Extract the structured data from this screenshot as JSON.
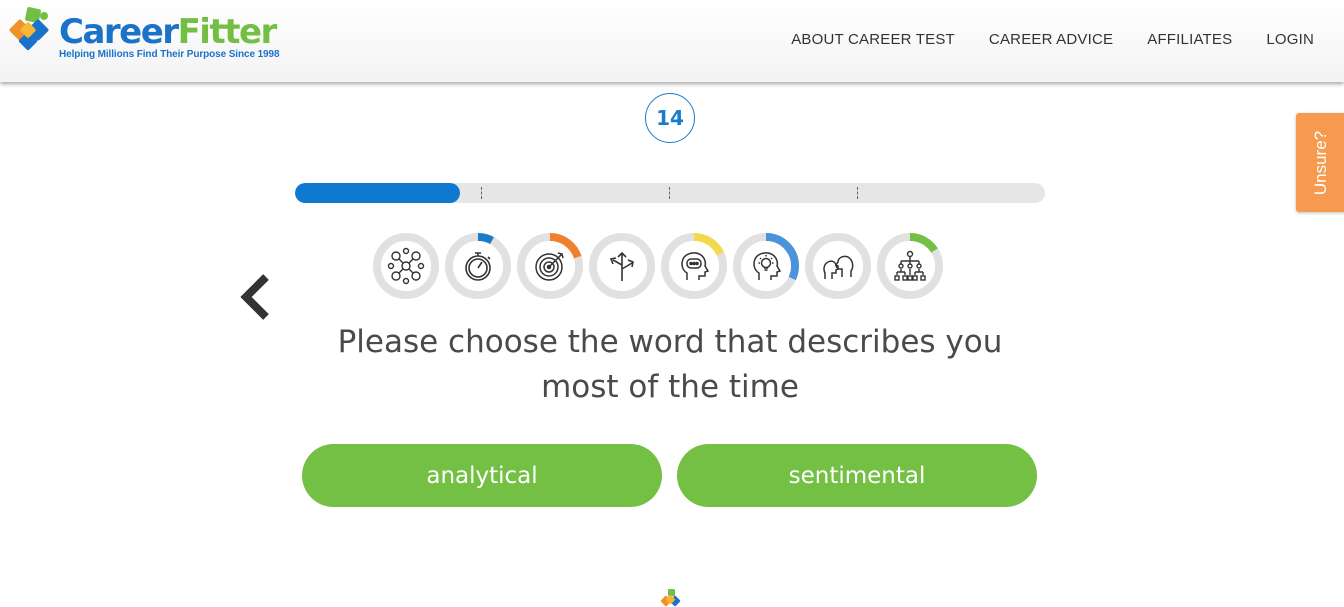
{
  "brand": {
    "name_part1": "Career",
    "name_part2": "Fitter",
    "tagline": "Helping Millions Find Their Purpose Since 1998",
    "blue": "#1a73c9",
    "green": "#72bf44",
    "orange": "#f0922b"
  },
  "nav": {
    "items": [
      {
        "label": "ABOUT CAREER TEST"
      },
      {
        "label": "CAREER ADVICE"
      },
      {
        "label": "AFFILIATES"
      },
      {
        "label": "LOGIN"
      }
    ]
  },
  "quiz": {
    "question_number": "14",
    "progress": 0.22,
    "sections": 4,
    "question": "Please choose the word that describes you most of the time",
    "answers": [
      {
        "label": "analytical"
      },
      {
        "label": "sentimental"
      }
    ],
    "unsure_label": "Unsure?",
    "back_icon": "chevron-left-icon"
  },
  "categories": [
    {
      "icon": "people-network-icon",
      "progress": 0,
      "color": "#1a7ccc"
    },
    {
      "icon": "stopwatch-icon",
      "progress": 0.08,
      "color": "#1a7ccc"
    },
    {
      "icon": "target-icon",
      "progress": 0.2,
      "color": "#f0802b"
    },
    {
      "icon": "crossroads-arrows-icon",
      "progress": 0,
      "color": "#1a7ccc"
    },
    {
      "icon": "head-speech-icon",
      "progress": 0.18,
      "color": "#f2d94e"
    },
    {
      "icon": "head-lightbulb-icon",
      "progress": 0.32,
      "color": "#4a94dc"
    },
    {
      "icon": "two-faces-icon",
      "progress": 0,
      "color": "#1a7ccc"
    },
    {
      "icon": "org-chart-icon",
      "progress": 0.16,
      "color": "#74c044"
    }
  ]
}
